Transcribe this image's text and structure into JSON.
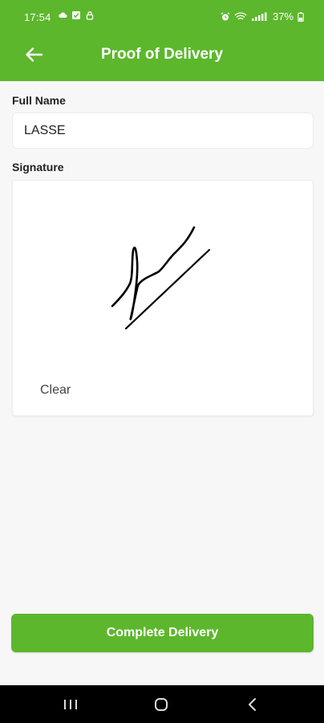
{
  "status_bar": {
    "time": "17:54",
    "battery": "37%"
  },
  "header": {
    "title": "Proof of Delivery"
  },
  "form": {
    "full_name_label": "Full Name",
    "full_name_value": "LASSE",
    "signature_label": "Signature",
    "clear_label": "Clear"
  },
  "footer": {
    "complete_label": "Complete Delivery"
  },
  "colors": {
    "brand_green": "#5cb72c",
    "background": "#f7f7f7"
  },
  "icons": [
    "cloud-icon",
    "check-square-icon",
    "lock-icon",
    "alarm-icon",
    "wifi-icon",
    "signal-icon",
    "battery-icon",
    "back-arrow-icon",
    "recents-icon",
    "home-icon",
    "back-nav-icon"
  ]
}
